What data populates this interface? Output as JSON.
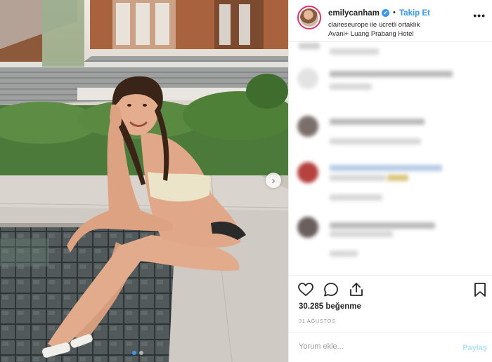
{
  "post": {
    "username": "emilycanham",
    "verified_mark": "✔",
    "separator": "•",
    "follow_label": "Takip Et",
    "partnership_line": "claireseurope ile ücretli ortaklık",
    "location": "Avani+ Luang Prabang Hotel",
    "more_label": "•••"
  },
  "photo": {
    "next_arrow": "›",
    "carousel_dots": 2,
    "active_dot": 0
  },
  "actions": {
    "like_icon": "heart-icon",
    "comment_icon": "comment-icon",
    "share_icon": "share-icon",
    "save_icon": "bookmark-icon"
  },
  "likes_text": "30.285 beğenme",
  "date_text": "31 AĞUSTOS",
  "comment_box": {
    "placeholder": "Yorum ekle...",
    "post_label": "Paylaş"
  },
  "colors": {
    "accent": "#3897f0",
    "post_disabled": "#b2dffc",
    "story_ring": "#e1306c"
  }
}
